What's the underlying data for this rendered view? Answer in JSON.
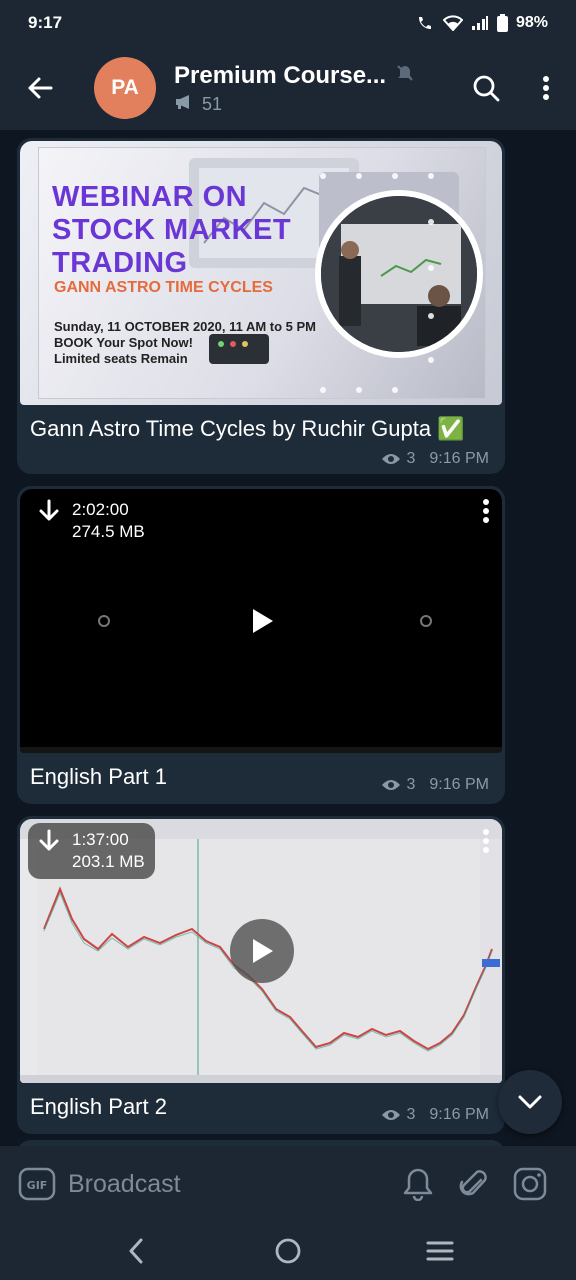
{
  "status_bar": {
    "time": "9:17",
    "battery": "98%"
  },
  "header": {
    "avatar_initials": "PA",
    "title": "Premium Course...",
    "subscribers": "51"
  },
  "messages": [
    {
      "type": "photo",
      "poster": {
        "headline": [
          "WEBINAR ON",
          "STOCK MARKET",
          "TRADING"
        ],
        "subheadline": "GANN ASTRO TIME CYCLES",
        "info": [
          "Sunday, 11 OCTOBER 2020, 11 AM to 5 PM",
          "BOOK Your Spot Now!",
          "Limited seats Remain"
        ]
      },
      "caption": "Gann Astro Time Cycles by Ruchir Gupta ✅",
      "views": "3",
      "time": "9:16 PM"
    },
    {
      "type": "video",
      "duration": "2:02:00",
      "size": "274.5 MB",
      "caption": "English Part 1",
      "views": "3",
      "time": "9:16 PM"
    },
    {
      "type": "video",
      "duration": "1:37:00",
      "size": "203.1 MB",
      "caption": "English Part 2",
      "views": "3",
      "time": "9:16 PM"
    }
  ],
  "input": {
    "placeholder": "Broadcast"
  },
  "colors": {
    "background": "#0e1621",
    "bar": "#1d2733",
    "bubble": "#1e2c3a",
    "avatar": "#e27f5c",
    "poster_title": "#6a36d6",
    "poster_sub": "#e56b3d"
  }
}
